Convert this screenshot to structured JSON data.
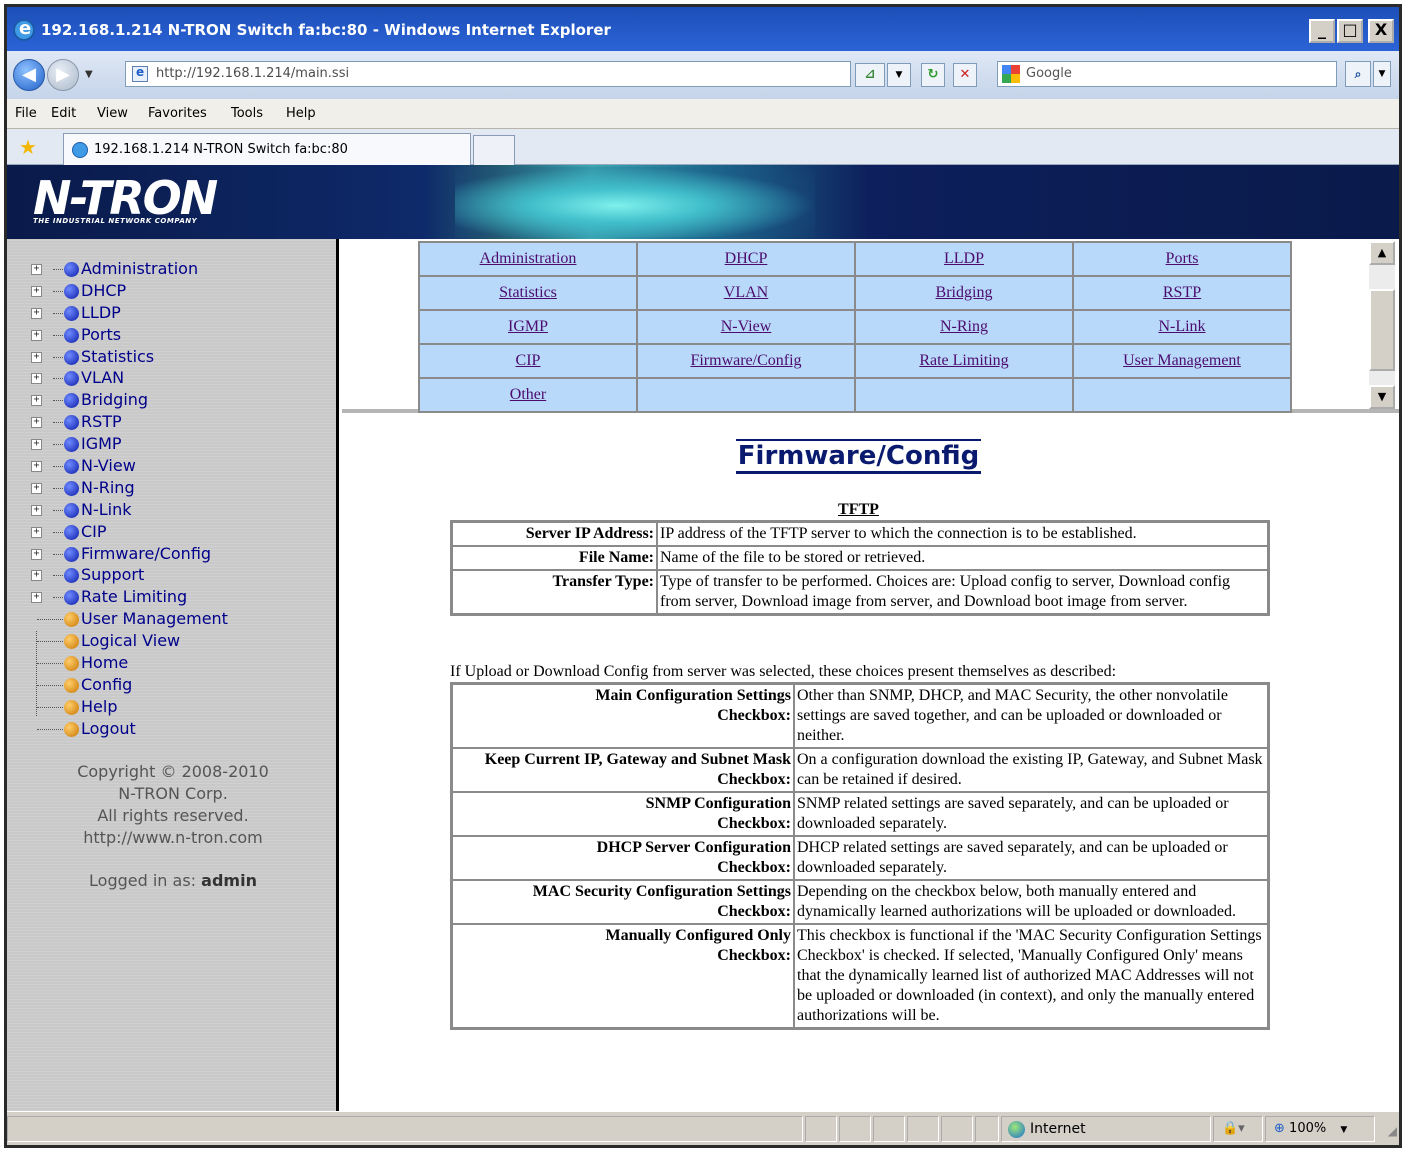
{
  "window": {
    "title": "192.168.1.214 N-TRON Switch fa:bc:80 - Windows Internet Explorer",
    "min_glyph": "_",
    "max_glyph": "□",
    "close_glyph": "X"
  },
  "address": {
    "url": "http://192.168.1.214/main.ssi",
    "search_placeholder": "Google"
  },
  "menu": [
    "File",
    "Edit",
    "View",
    "Favorites",
    "Tools",
    "Help"
  ],
  "tab": {
    "label": "192.168.1.214 N-TRON Switch fa:bc:80"
  },
  "banner": {
    "logo": "N-TRON",
    "tagline": "THE INDUSTRIAL NETWORK COMPANY"
  },
  "sidebar": {
    "expandable": [
      "Administration",
      "DHCP",
      "LLDP",
      "Ports",
      "Statistics",
      "VLAN",
      "Bridging",
      "RSTP",
      "IGMP",
      "N-View",
      "N-Ring",
      "N-Link",
      "CIP",
      "Firmware/Config",
      "Support",
      "Rate Limiting"
    ],
    "leaves": [
      "User Management",
      "Logical View",
      "Home",
      "Config",
      "Help",
      "Logout"
    ],
    "copyright": [
      "Copyright © 2008-2010",
      "N-TRON Corp.",
      "All rights reserved.",
      "http://www.n-tron.com"
    ],
    "logged_in_label": "Logged in as:",
    "logged_in_user": "admin"
  },
  "topnav": {
    "rows": [
      [
        "Administration",
        "DHCP",
        "LLDP",
        "Ports"
      ],
      [
        "Statistics",
        "VLAN",
        "Bridging",
        "RSTP"
      ],
      [
        "IGMP",
        "N-View",
        "N-Ring",
        "N-Link"
      ],
      [
        "CIP",
        "Firmware/Config",
        "Rate Limiting",
        "User Management"
      ],
      [
        "Other",
        "",
        "",
        ""
      ]
    ]
  },
  "main": {
    "title": "Firmware/Config",
    "tftp_title": "TFTP",
    "tftp_rows": [
      {
        "k": "Server IP Address:",
        "v": "IP address of the TFTP server to which the connection is to be established."
      },
      {
        "k": "File Name:",
        "v": "Name of the file to be stored or retrieved."
      },
      {
        "k": "Transfer Type:",
        "v": "Type of transfer to be performed. Choices are: Upload config to server, Download config from server, Download image from server, and Download boot image from server."
      }
    ],
    "intro": "If Upload or Download Config from server was selected, these choices present themselves as described:",
    "config_rows": [
      {
        "k1": "Main Configuration Settings",
        "k2": "Checkbox:",
        "v": "Other than SNMP, DHCP, and MAC Security, the other nonvolatile settings are saved together, and can be uploaded or downloaded or neither."
      },
      {
        "k1": "Keep Current IP, Gateway and Subnet Mask",
        "k2": "Checkbox:",
        "v": "On a configuration download the existing IP, Gateway, and Subnet Mask can be retained if desired."
      },
      {
        "k1": "SNMP Configuration",
        "k2": "Checkbox:",
        "v": "SNMP related settings are saved separately, and can be uploaded or downloaded separately."
      },
      {
        "k1": "DHCP Server Configuration",
        "k2": "Checkbox:",
        "v": "DHCP related settings are saved separately, and can be uploaded or downloaded separately."
      },
      {
        "k1": "MAC Security Configuration Settings",
        "k2": "Checkbox:",
        "v": "Depending on the checkbox below, both manually entered and dynamically learned authorizations will be uploaded or downloaded."
      },
      {
        "k1": "Manually Configured Only",
        "k2": "Checkbox:",
        "v": "This checkbox is functional if the 'MAC Security Configuration Settings Checkbox' is checked. If selected, 'Manually Configured Only' means that the dynamically learned list of authorized MAC Addresses will not be uploaded or downloaded (in context), and only the manually entered authorizations will be."
      }
    ]
  },
  "status": {
    "zone": "Internet",
    "zoom": "100%"
  }
}
